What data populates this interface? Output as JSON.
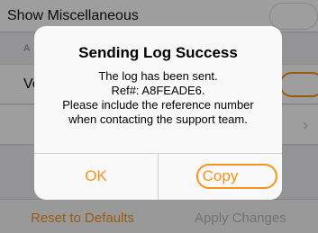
{
  "background": {
    "show_misc_label": "Show Miscellaneous",
    "section_header_fragment": "A",
    "row_label_fragment": "Ve",
    "chevron": "›",
    "bottom_bar": {
      "reset_label": "Reset to Defaults",
      "apply_label": "Apply Changes"
    }
  },
  "alert": {
    "title": "Sending Log Success",
    "message_lines": [
      "The log has been sent.",
      "Ref#: A8FEADE6.",
      "Please include the reference number",
      "when contacting the support team."
    ],
    "ok_label": "OK",
    "copy_label": "Copy"
  },
  "colors": {
    "accent": "#f7941d",
    "disabled_text": "#b8b8bb",
    "dim_overlay": "rgba(0,0,0,0.38)"
  }
}
